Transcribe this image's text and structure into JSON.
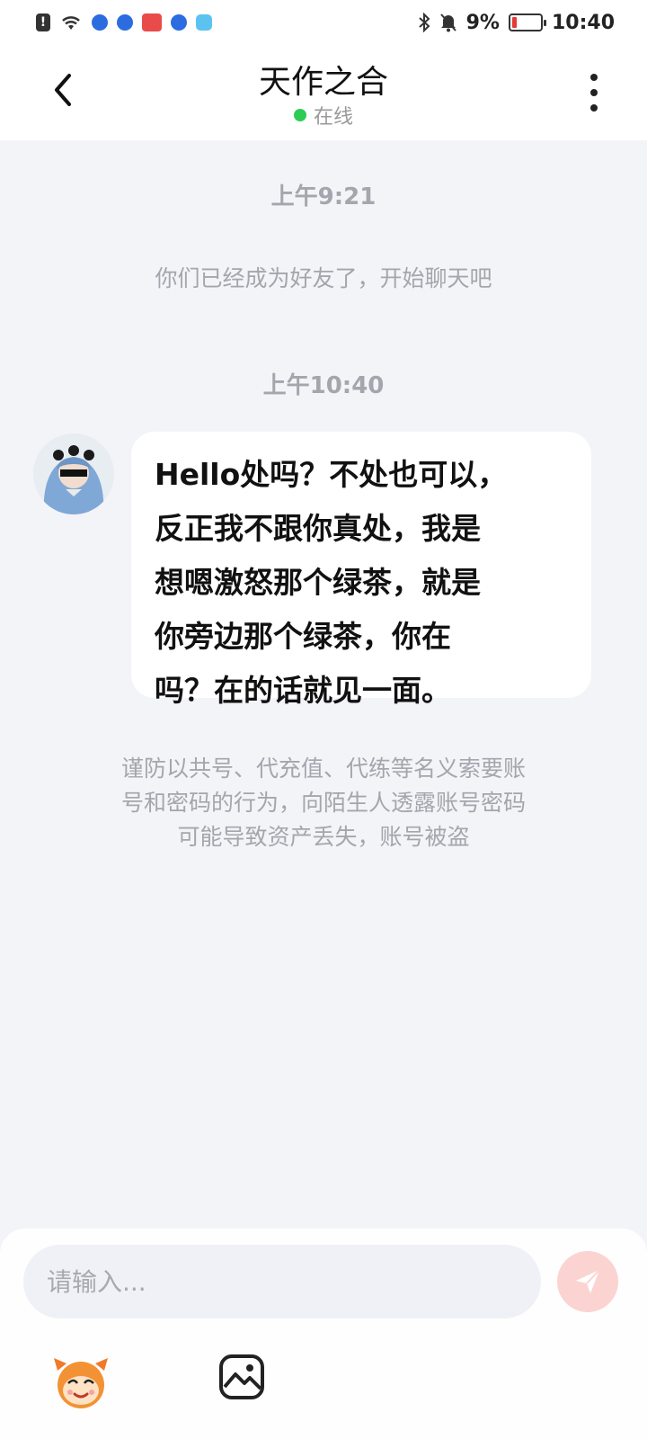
{
  "status_bar": {
    "battery_percent": "9%",
    "time": "10:40",
    "icons": [
      "alert-icon",
      "wifi-icon",
      "app-icon",
      "app-icon",
      "app-icon",
      "app-icon",
      "app-icon",
      "bluetooth-icon",
      "mute-icon",
      "battery-icon"
    ]
  },
  "header": {
    "title": "天作之合",
    "status": "在线",
    "status_color": "#2ecc55"
  },
  "chat": {
    "time_1": "上午9:21",
    "system_note": "你们已经成为好友了，开始聊天吧",
    "time_2": "上午10:40",
    "messages": [
      {
        "sender": "other",
        "lines": [
          "Hello处吗？不处也可以，",
          "反正我不跟你真处，我是",
          "想嗯激怒那个绿茶，就是",
          "你旁边那个绿茶，你在",
          "吗？在的话就见一面。"
        ]
      }
    ],
    "warning_lines": [
      "谨防以共号、代充值、代练等名义索要账",
      "号和密码的行为，向陌生人透露账号密码",
      "可能导致资产丢失，账号被盗"
    ]
  },
  "input": {
    "placeholder": "请输入...",
    "value": "",
    "send_color": "#fbd4d2"
  },
  "toolbar": {
    "icons": [
      "emoji-icon",
      "image-icon"
    ]
  }
}
